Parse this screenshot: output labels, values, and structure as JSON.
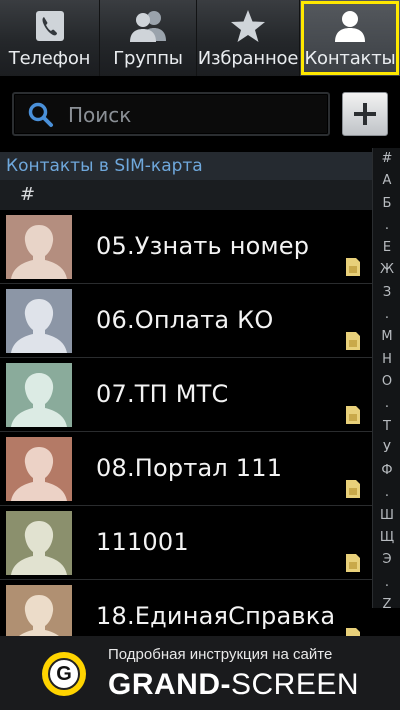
{
  "tabs": [
    {
      "label": "Телефон",
      "icon": "phone-icon"
    },
    {
      "label": "Группы",
      "icon": "group-icon"
    },
    {
      "label": "Избранное",
      "icon": "star-icon"
    },
    {
      "label": "Контакты",
      "icon": "contact-icon",
      "active": true
    }
  ],
  "search": {
    "placeholder": "Поиск",
    "value": ""
  },
  "add_button": {
    "icon": "plus-icon"
  },
  "section_title": "Контакты в SIM-карта",
  "group_header": "#",
  "contacts": [
    {
      "name": "05.Узнать номер",
      "avatar_color": "#b48e7f",
      "storage_icon": "sim-card-icon"
    },
    {
      "name": "06.Оплата КО",
      "avatar_color": "#8c96a6",
      "storage_icon": "sim-card-icon"
    },
    {
      "name": "07.ТП МТС",
      "avatar_color": "#8aab9b",
      "storage_icon": "sim-card-icon"
    },
    {
      "name": "08.Портал 111",
      "avatar_color": "#b47a66",
      "storage_icon": "sim-card-icon"
    },
    {
      "name": "111001",
      "avatar_color": "#8b906d",
      "storage_icon": "sim-card-icon"
    },
    {
      "name": "18.ЕдинаяСправка",
      "avatar_color": "#b09072",
      "storage_icon": "sim-card-icon"
    }
  ],
  "alphabet_index": [
    "#",
    "А",
    "Б",
    ".",
    "Е",
    "Ж",
    "З",
    ".",
    "М",
    "Н",
    "О",
    ".",
    "Т",
    "У",
    "Ф",
    ".",
    "Ш",
    "Щ",
    "Э",
    ".",
    "Z"
  ],
  "banner": {
    "line1": "Подробная инструкция на сайте",
    "brand_bold": "GRAND-",
    "brand_regular": "SCREEN",
    "logo_letter": "G"
  },
  "colors": {
    "active_tab_border": "#ffe800",
    "section_text": "#6fa8dc",
    "banner_logo": "#ffd400"
  }
}
